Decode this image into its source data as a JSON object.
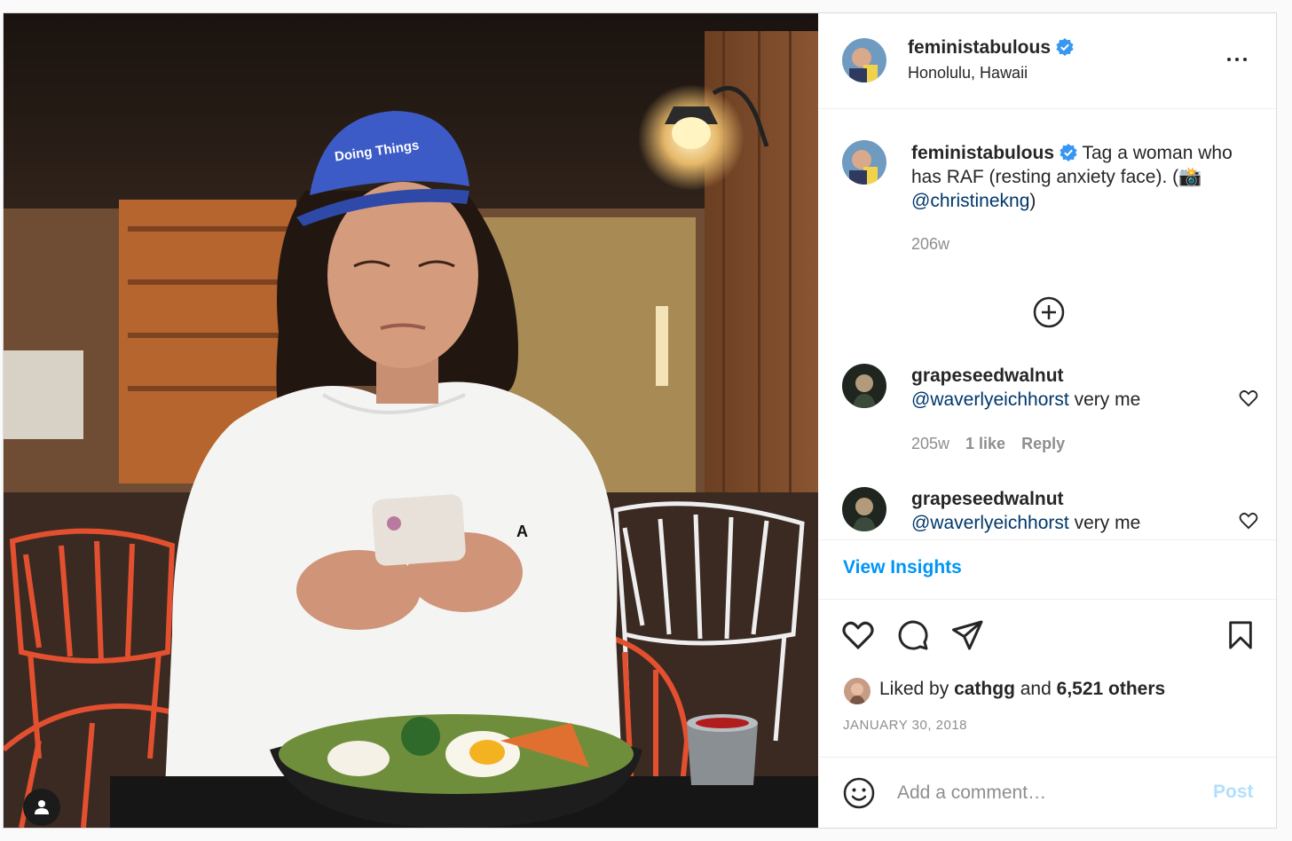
{
  "post": {
    "author": "feministabulous",
    "location": "Honolulu, Hawaii",
    "caption": {
      "author": "feministabulous",
      "text": "Tag a woman who has RAF (resting anxiety face). (📸",
      "mention": "@christinekng",
      "close": ")",
      "age": "206w"
    },
    "photo": {
      "cap_text": "Doing Things",
      "sweater_text": "A"
    },
    "comments": [
      {
        "user": "grapeseedwalnut",
        "mention": "@waverlyeichhorst",
        "text": "very me",
        "age": "205w",
        "likes": "1 like",
        "reply": "Reply"
      },
      {
        "user": "grapeseedwalnut",
        "mention": "@waverlyeichhorst",
        "text": "very me"
      }
    ],
    "view_insights": "View Insights",
    "liked_by": {
      "prefix": "Liked by",
      "user": "cathgg",
      "and": "and",
      "others": "6,521 others"
    },
    "date": "JANUARY 30, 2018",
    "comment_placeholder": "Add a comment…",
    "post_label": "Post"
  },
  "colors": {
    "verified": "#3897f0",
    "link": "#0095f6",
    "mention": "#00376b",
    "secondary": "#8e8e8e"
  },
  "icons": [
    "verified-icon",
    "more-icon",
    "add-comment-icon",
    "heart-icon",
    "comment-icon",
    "share-icon",
    "bookmark-icon",
    "emoji-icon",
    "user-tag-icon"
  ]
}
